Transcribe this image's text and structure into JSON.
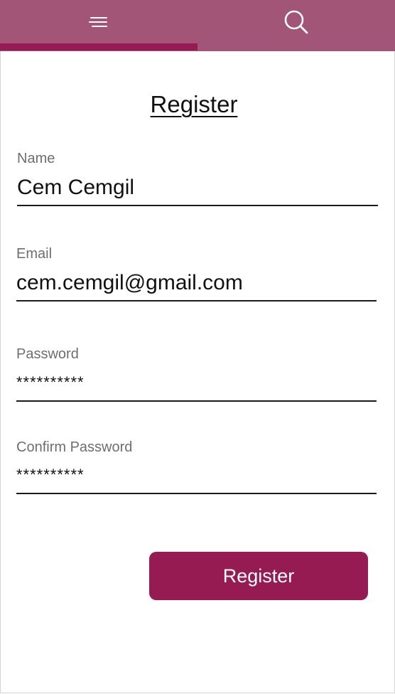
{
  "nav": {
    "menu_icon": "menu-icon",
    "search_icon": "search-icon",
    "bar_color": "#a25576",
    "indicator_color": "#971b53"
  },
  "form": {
    "title": "Register",
    "fields": {
      "name": {
        "label": "Name",
        "value": "Cem Cemgil"
      },
      "email": {
        "label": "Email",
        "value": "cem.cemgil@gmail.com"
      },
      "password": {
        "label": "Password",
        "value": "**********"
      },
      "confirm_password": {
        "label": "Confirm Password",
        "value": "**********"
      }
    },
    "submit_label": "Register",
    "submit_color": "#971b53"
  }
}
